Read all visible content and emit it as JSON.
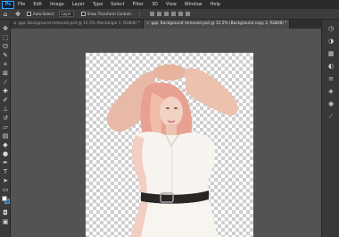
{
  "app": {
    "logo_text": "Ps"
  },
  "menubar": {
    "items": [
      "File",
      "Edit",
      "Image",
      "Layer",
      "Type",
      "Select",
      "Filter",
      "3D",
      "View",
      "Window",
      "Help"
    ]
  },
  "options": {
    "auto_select_label": "Auto-Select:",
    "layer_select_value": "Layer",
    "show_transform_label": "Show Transform Controls"
  },
  "tabs": [
    {
      "label": "gqz, Background removed.psd @ 12.5% (Rectangle 1, RGB/8) *",
      "active": false
    },
    {
      "label": "gqz, Background removed.psd @ 12.5% (Background copy 2, RGB/8) *",
      "active": true
    }
  ],
  "colors": {
    "foreground": "#ffffff",
    "background": "#1e6fd0",
    "accent": "#31a8ff"
  }
}
